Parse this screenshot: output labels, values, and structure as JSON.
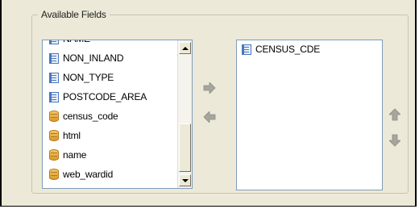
{
  "group": {
    "title": "Available Fields"
  },
  "available_fields": [
    {
      "label": "NAME",
      "icon": "field-icon"
    },
    {
      "label": "NON_INLAND",
      "icon": "field-icon"
    },
    {
      "label": "NON_TYPE",
      "icon": "field-icon"
    },
    {
      "label": "POSTCODE_AREA",
      "icon": "field-icon"
    },
    {
      "label": "census_code",
      "icon": "database-field-icon"
    },
    {
      "label": "html",
      "icon": "database-field-icon"
    },
    {
      "label": "name",
      "icon": "database-field-icon"
    },
    {
      "label": "web_wardid",
      "icon": "database-field-icon"
    }
  ],
  "selected_fields": [
    {
      "label": "CENSUS_CDE",
      "icon": "field-icon"
    }
  ],
  "colors": {
    "arrow_disabled": "#a6a59e",
    "list_border": "#7f9db9",
    "panel_bg": "#ece9d8"
  }
}
